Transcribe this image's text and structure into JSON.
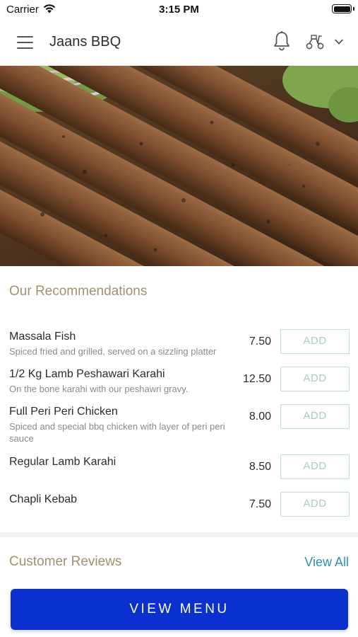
{
  "status_bar": {
    "carrier": "Carrier",
    "time": "3:15 PM"
  },
  "header": {
    "title": "Jaans BBQ",
    "icons": [
      "menu-icon",
      "bell-icon",
      "scooter-icon",
      "chevron-down-icon"
    ]
  },
  "hero": {
    "image": "grilled seekh kebabs"
  },
  "recommendations": {
    "title": "Our Recommendations",
    "add_label": "ADD",
    "items": [
      {
        "name": "Massala Fish",
        "description": "Spiced fried and grilled, served on a sizzling platter",
        "price": "7.50"
      },
      {
        "name": "1/2 Kg Lamb Peshawari Karahi",
        "description": "On the bone karahi with our peshawri gravy.",
        "price": "12.50"
      },
      {
        "name": "Full Peri Peri Chicken",
        "description": "Spiced and special bbq chicken with layer of peri peri sauce",
        "price": "8.00"
      },
      {
        "name": "Regular Lamb Karahi",
        "description": "",
        "price": "8.50"
      },
      {
        "name": "Chapli Kebab",
        "description": "",
        "price": "7.50"
      }
    ]
  },
  "reviews": {
    "title": "Customer Reviews",
    "view_all": "View All"
  },
  "cta": {
    "view_menu": "VIEW MENU"
  },
  "colors": {
    "accent_gold": "#a38f6e",
    "link_blue": "#2a8fc0",
    "button_blue": "#0a31cf",
    "add_green": "#b9dfc8"
  }
}
